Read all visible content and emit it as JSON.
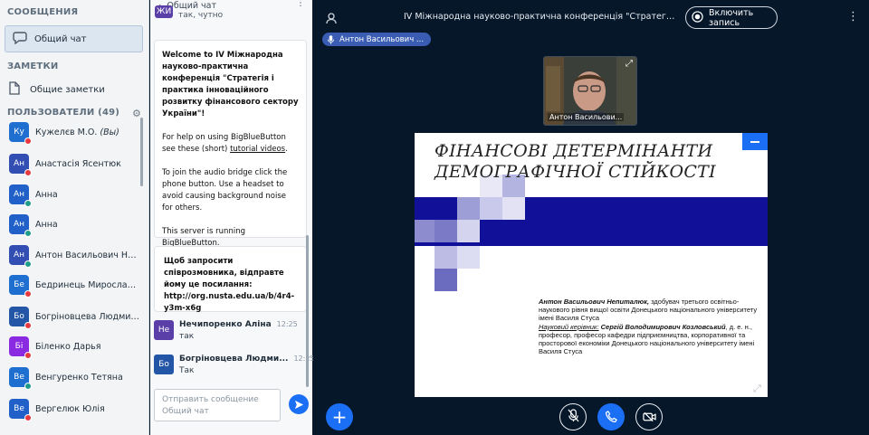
{
  "sidebar": {
    "messages_header": "СООБЩЕНИЯ",
    "public_chat_label": "Общий чат",
    "notes_header": "ЗАМЕТКИ",
    "shared_notes_label": "Общие заметки",
    "users_header": "ПОЛЬЗОВАТЕЛИ (49)",
    "users": [
      {
        "initials": "Ку",
        "name": "Кужелєв М.О.",
        "suffix": " (Вы)",
        "color": "#1f6fd1",
        "status_color": "#e5393f"
      },
      {
        "initials": "Ан",
        "name": "Анастасія Ясентюк",
        "suffix": "",
        "color": "#334eb3",
        "status_color": "#e5393f"
      },
      {
        "initials": "Ан",
        "name": "Анна",
        "suffix": "",
        "color": "#2060c8",
        "status_color": "#1e9b8a"
      },
      {
        "initials": "Ан",
        "name": "Анна",
        "suffix": "",
        "color": "#2060c8",
        "status_color": "#1e9b8a"
      },
      {
        "initials": "Ан",
        "name": "Антон Васильович Непи...",
        "suffix": "",
        "color": "#334eb3",
        "status_color": "#1e9b8a"
      },
      {
        "initials": "Бе",
        "name": "Бедринець Мирослава ...",
        "suffix": "",
        "color": "#1f6fd1",
        "status_color": "#e5393f"
      },
      {
        "initials": "Бо",
        "name": "Богріновцева Людмила",
        "suffix": "",
        "color": "#2456a8",
        "status_color": "#e5393f"
      },
      {
        "initials": "Бі",
        "name": "Біленко Дарья",
        "suffix": "",
        "color": "#8a2be2",
        "status_color": "#e5393f"
      },
      {
        "initials": "Ве",
        "name": "Венгуренко Тетяна",
        "suffix": "",
        "color": "#1f6fd1",
        "status_color": "#1e9b8a"
      },
      {
        "initials": "Ве",
        "name": "Вергелюк Юлія",
        "suffix": "",
        "color": "#2060c8",
        "status_color": "#e5393f"
      }
    ]
  },
  "chat": {
    "title": "Общий чат",
    "top_initials": "ЖИ",
    "top_text": "так, чутно",
    "welcome_intro": "Welcome to ",
    "welcome_bold": "IV Міжнародна науково-практична конференція \"Стратегія і практика інноваційного розвитку фінансового сектору України\"",
    "welcome_excl": "!",
    "help_text_1": "For help on using BigBlueButton see these (short) ",
    "help_link": "tutorial videos",
    "help_text_2": ".",
    "audio_text": "To join the audio bridge click the phone button. Use a headset to avoid causing background noise for others.",
    "server_text": "This server is running ",
    "server_link": "BigBlueButton",
    "server_end": ".",
    "invite_text": "Щоб запросити співрозмовника, відправте йому це посилання: http://org.nusta.edu.ua/b/4r4-y3m-x6g",
    "messages": [
      {
        "initials": "Не",
        "author": "Нечипоренко Аліна",
        "time": "12:25",
        "text": "так",
        "color": "#5b3fa8"
      },
      {
        "initials": "Бо",
        "author": "Богріновцева Людми...",
        "time": "12:25",
        "text": "Так",
        "color": "#2456a8"
      }
    ],
    "input_placeholder": "Отправить сообщение Общий чат"
  },
  "main": {
    "meeting_title": "IV Міжнародна науково-практична конференція \"Стратегія і практи...",
    "record_label": "Включить запись",
    "talker_name": "Антон Васильович ...",
    "camera_name": "Антон Васильови...",
    "slide": {
      "title_line1": "ФІНАНСОВІ ДЕТЕРМІНАНТИ",
      "title_line2": "ДЕМОГРАФІЧНОЇ СТІЙКОСТІ",
      "author_name": "Антон Васильович Непиталюк,",
      "author_desc": " здобувач третього освітньо-наукового рівня вищої освіти Донецького національного університету імені Василя Стуса",
      "supervisor_label": "Науковий керівник:",
      "supervisor_name": " Сергій Володимирович Козловський",
      "supervisor_desc": ", д. е. н., професор, професор кафедри підприємництва, корпоративної та просторової економіки Донецького національного університету імені Василя Стуса"
    }
  },
  "icons": {
    "chat": "chat-bubble-icon",
    "notes": "document-icon",
    "settings": "gear-icon",
    "back": "chevron-left-icon",
    "more": "more-vertical-icon",
    "send": "send-icon",
    "user": "user-icon",
    "record": "record-icon",
    "mic": "microphone-icon",
    "expand": "expand-icon",
    "plus": "plus-icon",
    "mic_muted": "microphone-muted-icon",
    "phone": "phone-icon",
    "camera_off": "camera-off-icon"
  },
  "colors": {
    "primary": "#1b6ff5",
    "background": "#06172a",
    "slide_band": "#101099"
  }
}
